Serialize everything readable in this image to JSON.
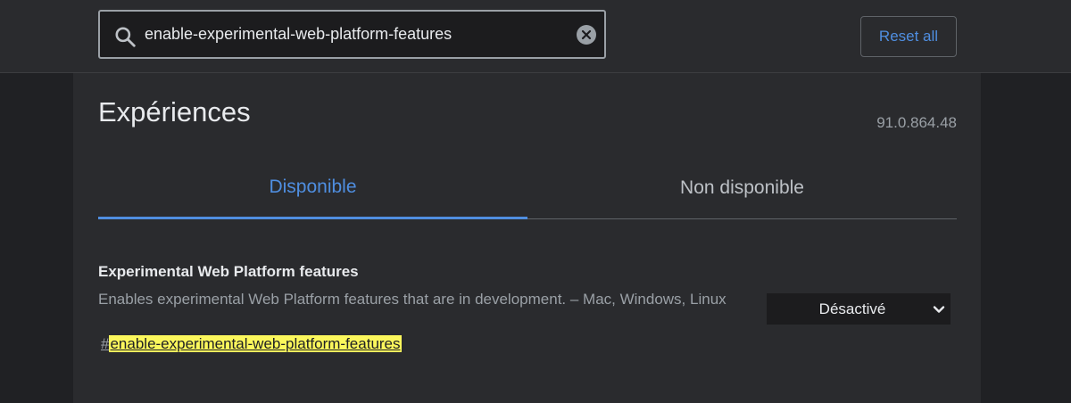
{
  "header": {
    "search_value": "enable-experimental-web-platform-features",
    "reset_label": "Reset all",
    "icons": {
      "search": "search-icon",
      "clear": "clear-icon"
    }
  },
  "page": {
    "title": "Expériences",
    "version": "91.0.864.48"
  },
  "tabs": [
    {
      "label": "Disponible",
      "active": true
    },
    {
      "label": "Non disponible",
      "active": false
    }
  ],
  "experiment": {
    "title": "Experimental Web Platform features",
    "description": "Enables experimental Web Platform features that are in development. – Mac, Windows, Linux",
    "hash": "#",
    "link": "enable-experimental-web-platform-features",
    "selected_option": "Désactivé"
  },
  "colors": {
    "background": "#202124",
    "panel": "#2a2b2e",
    "accent": "#4f8ee0",
    "highlight": "#fbf75c"
  }
}
